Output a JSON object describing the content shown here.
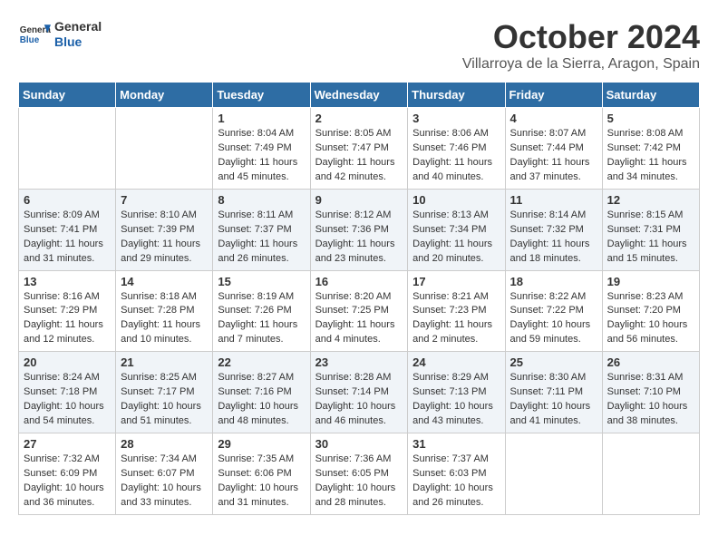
{
  "header": {
    "logo_line1": "General",
    "logo_line2": "Blue",
    "month_title": "October 2024",
    "location": "Villarroya de la Sierra, Aragon, Spain"
  },
  "weekdays": [
    "Sunday",
    "Monday",
    "Tuesday",
    "Wednesday",
    "Thursday",
    "Friday",
    "Saturday"
  ],
  "weeks": [
    [
      {
        "day": "",
        "info": ""
      },
      {
        "day": "",
        "info": ""
      },
      {
        "day": "1",
        "info": "Sunrise: 8:04 AM\nSunset: 7:49 PM\nDaylight: 11 hours and 45 minutes."
      },
      {
        "day": "2",
        "info": "Sunrise: 8:05 AM\nSunset: 7:47 PM\nDaylight: 11 hours and 42 minutes."
      },
      {
        "day": "3",
        "info": "Sunrise: 8:06 AM\nSunset: 7:46 PM\nDaylight: 11 hours and 40 minutes."
      },
      {
        "day": "4",
        "info": "Sunrise: 8:07 AM\nSunset: 7:44 PM\nDaylight: 11 hours and 37 minutes."
      },
      {
        "day": "5",
        "info": "Sunrise: 8:08 AM\nSunset: 7:42 PM\nDaylight: 11 hours and 34 minutes."
      }
    ],
    [
      {
        "day": "6",
        "info": "Sunrise: 8:09 AM\nSunset: 7:41 PM\nDaylight: 11 hours and 31 minutes."
      },
      {
        "day": "7",
        "info": "Sunrise: 8:10 AM\nSunset: 7:39 PM\nDaylight: 11 hours and 29 minutes."
      },
      {
        "day": "8",
        "info": "Sunrise: 8:11 AM\nSunset: 7:37 PM\nDaylight: 11 hours and 26 minutes."
      },
      {
        "day": "9",
        "info": "Sunrise: 8:12 AM\nSunset: 7:36 PM\nDaylight: 11 hours and 23 minutes."
      },
      {
        "day": "10",
        "info": "Sunrise: 8:13 AM\nSunset: 7:34 PM\nDaylight: 11 hours and 20 minutes."
      },
      {
        "day": "11",
        "info": "Sunrise: 8:14 AM\nSunset: 7:32 PM\nDaylight: 11 hours and 18 minutes."
      },
      {
        "day": "12",
        "info": "Sunrise: 8:15 AM\nSunset: 7:31 PM\nDaylight: 11 hours and 15 minutes."
      }
    ],
    [
      {
        "day": "13",
        "info": "Sunrise: 8:16 AM\nSunset: 7:29 PM\nDaylight: 11 hours and 12 minutes."
      },
      {
        "day": "14",
        "info": "Sunrise: 8:18 AM\nSunset: 7:28 PM\nDaylight: 11 hours and 10 minutes."
      },
      {
        "day": "15",
        "info": "Sunrise: 8:19 AM\nSunset: 7:26 PM\nDaylight: 11 hours and 7 minutes."
      },
      {
        "day": "16",
        "info": "Sunrise: 8:20 AM\nSunset: 7:25 PM\nDaylight: 11 hours and 4 minutes."
      },
      {
        "day": "17",
        "info": "Sunrise: 8:21 AM\nSunset: 7:23 PM\nDaylight: 11 hours and 2 minutes."
      },
      {
        "day": "18",
        "info": "Sunrise: 8:22 AM\nSunset: 7:22 PM\nDaylight: 10 hours and 59 minutes."
      },
      {
        "day": "19",
        "info": "Sunrise: 8:23 AM\nSunset: 7:20 PM\nDaylight: 10 hours and 56 minutes."
      }
    ],
    [
      {
        "day": "20",
        "info": "Sunrise: 8:24 AM\nSunset: 7:18 PM\nDaylight: 10 hours and 54 minutes."
      },
      {
        "day": "21",
        "info": "Sunrise: 8:25 AM\nSunset: 7:17 PM\nDaylight: 10 hours and 51 minutes."
      },
      {
        "day": "22",
        "info": "Sunrise: 8:27 AM\nSunset: 7:16 PM\nDaylight: 10 hours and 48 minutes."
      },
      {
        "day": "23",
        "info": "Sunrise: 8:28 AM\nSunset: 7:14 PM\nDaylight: 10 hours and 46 minutes."
      },
      {
        "day": "24",
        "info": "Sunrise: 8:29 AM\nSunset: 7:13 PM\nDaylight: 10 hours and 43 minutes."
      },
      {
        "day": "25",
        "info": "Sunrise: 8:30 AM\nSunset: 7:11 PM\nDaylight: 10 hours and 41 minutes."
      },
      {
        "day": "26",
        "info": "Sunrise: 8:31 AM\nSunset: 7:10 PM\nDaylight: 10 hours and 38 minutes."
      }
    ],
    [
      {
        "day": "27",
        "info": "Sunrise: 7:32 AM\nSunset: 6:09 PM\nDaylight: 10 hours and 36 minutes."
      },
      {
        "day": "28",
        "info": "Sunrise: 7:34 AM\nSunset: 6:07 PM\nDaylight: 10 hours and 33 minutes."
      },
      {
        "day": "29",
        "info": "Sunrise: 7:35 AM\nSunset: 6:06 PM\nDaylight: 10 hours and 31 minutes."
      },
      {
        "day": "30",
        "info": "Sunrise: 7:36 AM\nSunset: 6:05 PM\nDaylight: 10 hours and 28 minutes."
      },
      {
        "day": "31",
        "info": "Sunrise: 7:37 AM\nSunset: 6:03 PM\nDaylight: 10 hours and 26 minutes."
      },
      {
        "day": "",
        "info": ""
      },
      {
        "day": "",
        "info": ""
      }
    ]
  ]
}
